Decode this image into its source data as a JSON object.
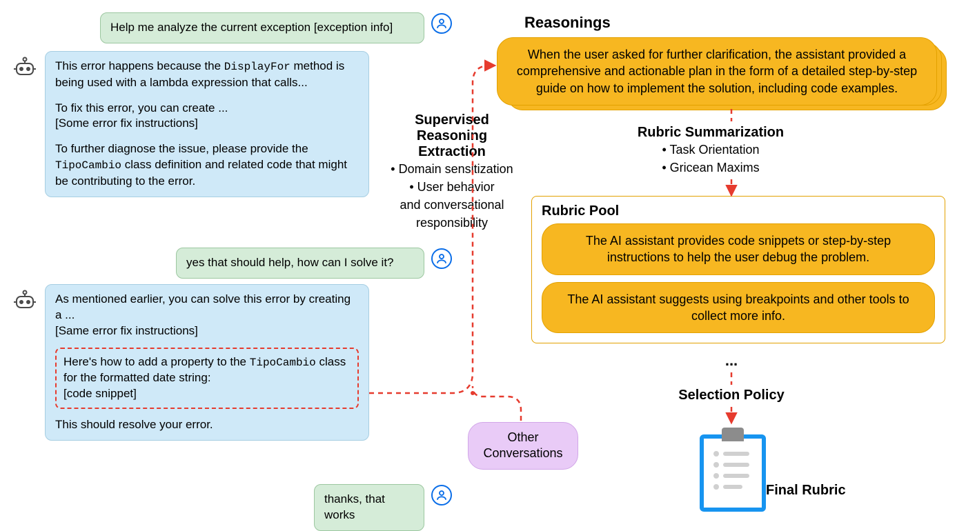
{
  "chat": {
    "user1": "Help me analyze the current exception [exception info]",
    "ai1_p1a": "This error happens because the ",
    "ai1_p1_code": "DisplayFor",
    "ai1_p1b": " method is being used with a lambda expression that calls...",
    "ai1_p2": "To fix this error, you can create ...",
    "ai1_p3": "[Some error fix instructions]",
    "ai1_p4a": "To further diagnose the issue, please provide the ",
    "ai1_p4_code": "TipoCambio",
    "ai1_p4b": " class definition and related code that might be contributing to the error.",
    "user2": "yes that should help, how can I solve it?",
    "ai2_p1": "As mentioned earlier, you can solve this error by creating a ...",
    "ai2_p2": "[Same error fix instructions]",
    "ai2_highlight_a": "Here's how to add a property to the ",
    "ai2_highlight_code": "TipoCambio",
    "ai2_highlight_b": " class for the formatted date string:",
    "ai2_highlight_c": "[code snippet]",
    "ai2_p3": "This should resolve your error.",
    "user3": "thanks, that works"
  },
  "stage_reasoning_extraction": {
    "title": "Supervised Reasoning Extraction",
    "bullet1": "Domain sensitization",
    "bullet2_line1": "User behavior",
    "bullet2_line2": "and conversational",
    "bullet2_line3": "responsibility"
  },
  "reasonings": {
    "title": "Reasonings",
    "card_text": "When the user asked for further clarification, the assistant provided a comprehensive and actionable plan in the form of a detailed step-by-step guide on how to implement the solution, including code examples."
  },
  "rubric_summarization": {
    "title": "Rubric Summarization",
    "bullet1": "Task Orientation",
    "bullet2": "Gricean Maxims"
  },
  "rubric_pool": {
    "title": "Rubric Pool",
    "item1": "The AI assistant provides code snippets or step-by-step instructions to help the user debug the problem.",
    "item2": "The AI assistant suggests using breakpoints and other tools to collect more info.",
    "ellipsis": "..."
  },
  "other_conversations": "Other Conversations",
  "selection_policy": "Selection Policy",
  "final_rubric": "Final Rubric"
}
